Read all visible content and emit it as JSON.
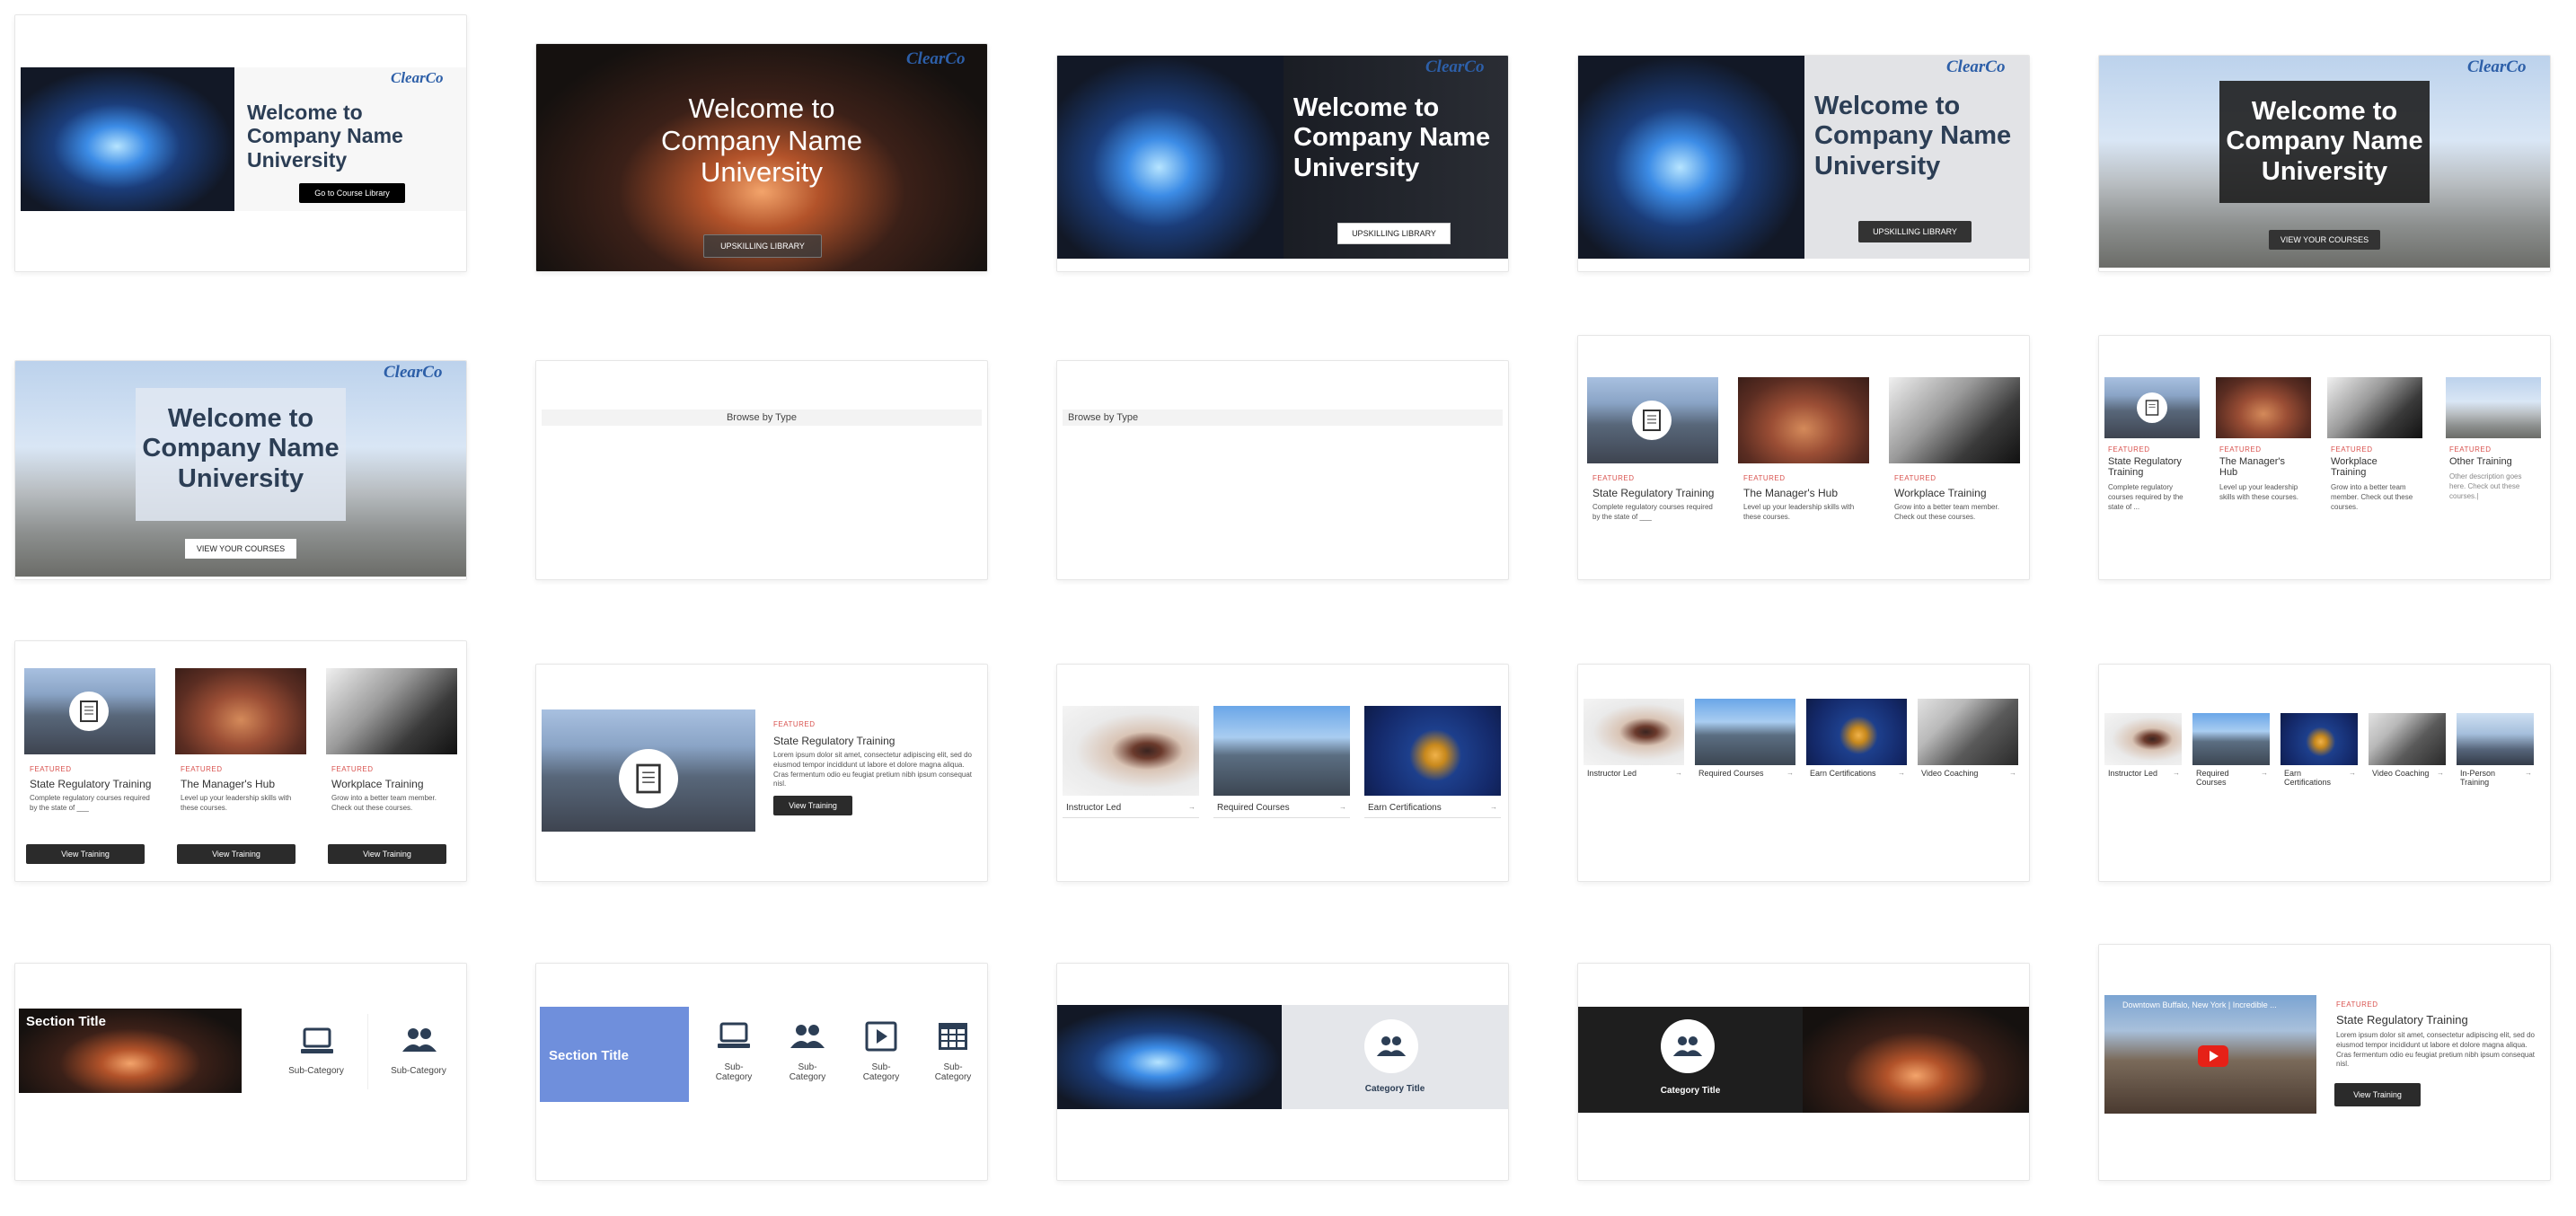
{
  "brand": {
    "logo": "ClearCo",
    "accent": "#2d5fa8",
    "featured_color": "#d9534f",
    "section_blue": "#6f8fdc"
  },
  "hero": {
    "line1": "Welcome to",
    "line2": "Company Name",
    "line3": "University",
    "btn_course_library": "Go to Course Library",
    "btn_upskilling_spaced": "UPSKILLING LIBRARY",
    "btn_upskilling": "UPSKILLING LIBRARY",
    "btn_view_courses": "VIEW YOUR COURSES"
  },
  "browse": {
    "title": "Browse by Type"
  },
  "tiles": {
    "featured": "FEATURED",
    "state_title": "State Regulatory Training",
    "state_desc": "Complete regulatory courses required by the state of ___",
    "state_desc_short": "Complete regulatory courses required by the state of ...",
    "hub_title": "The Manager's Hub",
    "hub_desc": "Level up your leadership skills with these courses.",
    "workplace_title": "Workplace Training",
    "workplace_desc": "Grow into a better team member. Check out these courses.",
    "other_title": "Other Training",
    "other_desc": "Other description goes here. Check out these courses.|",
    "view_training": "View Training",
    "lorem": "Lorem ipsum dolor sit amet, consectetur adipiscing elit, sed do eiusmod tempor incididunt ut labore et dolore magna aliqua. Cras fermentum odio eu feugiat pretium nibh ipsum consequat nisl."
  },
  "categories": {
    "instructor": "Instructor Led",
    "required": "Required Courses",
    "earn": "Earn Certifications",
    "video": "Video Coaching",
    "in_person": "In-Person Training",
    "arrow": "→"
  },
  "sections": {
    "section_title": "Section Title",
    "sub_category": "Sub-Category",
    "sub": "Sub-",
    "category": "Category",
    "category_title": "Category Title"
  },
  "video": {
    "caption": "Downtown Buffalo, New York | Incredible ..."
  }
}
